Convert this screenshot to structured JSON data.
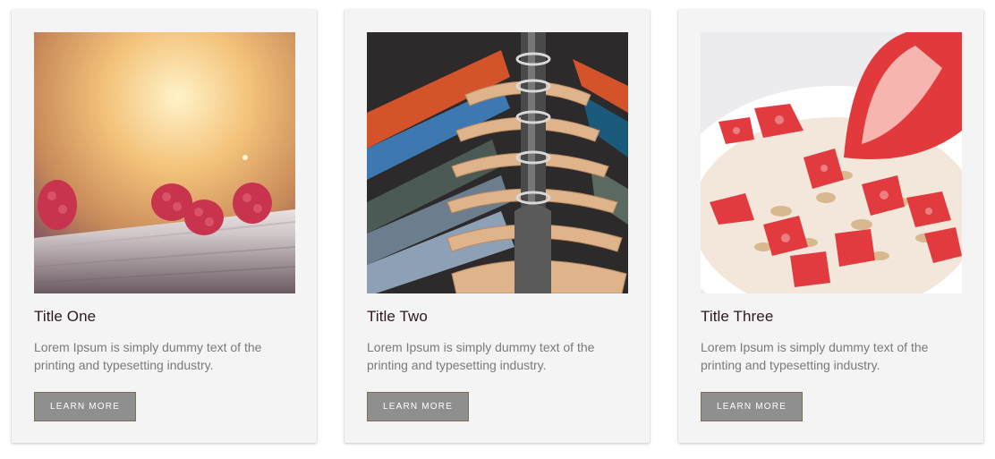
{
  "cards": [
    {
      "image_subject": "raspberries on wooden ledge",
      "title": "Title One",
      "text": "Lorem Ipsum is simply dummy text of the printing and typesetting industry.",
      "button_label": "LEARN MORE"
    },
    {
      "image_subject": "clothes on wooden hangers",
      "title": "Title Two",
      "text": "Lorem Ipsum is simply dummy text of the printing and typesetting industry.",
      "button_label": "LEARN MORE"
    },
    {
      "image_subject": "strawberries with oats in bowl",
      "title": "Title Three",
      "text": "Lorem Ipsum is simply dummy text of the printing and typesetting industry.",
      "button_label": "LEARN MORE"
    }
  ],
  "colors": {
    "card_background": "#f4f4f4",
    "button_background": "#8f8f8f",
    "title_color": "#2b1a1f",
    "text_color": "#7a7a7a"
  }
}
